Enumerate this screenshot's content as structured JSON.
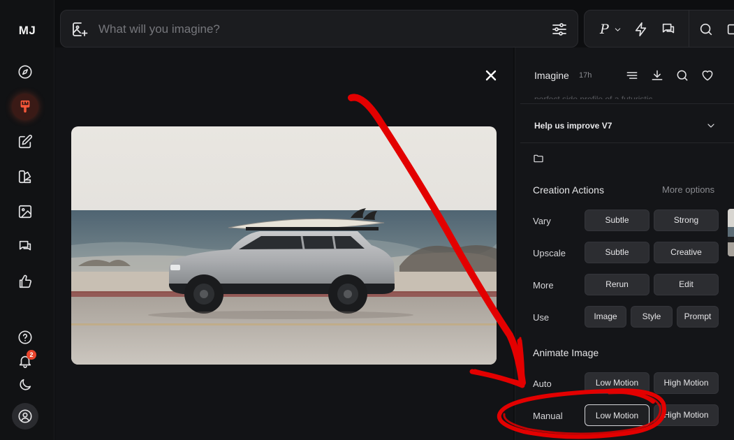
{
  "sidebar": {
    "logo": "MJ",
    "items": [
      {
        "name": "explore",
        "icon": "compass-icon"
      },
      {
        "name": "create",
        "icon": "paintbrush-icon",
        "active": true
      },
      {
        "name": "edit",
        "icon": "edit-icon"
      },
      {
        "name": "personalize",
        "icon": "palette-icon"
      },
      {
        "name": "organize",
        "icon": "image-icon"
      },
      {
        "name": "chat",
        "icon": "chat-icon"
      },
      {
        "name": "rank",
        "icon": "thumbs-up-icon"
      }
    ],
    "bottom": [
      {
        "name": "help",
        "icon": "help-icon"
      },
      {
        "name": "notifications",
        "icon": "bell-icon",
        "badge": "2"
      },
      {
        "name": "theme",
        "icon": "moon-icon"
      },
      {
        "name": "account",
        "icon": "user-icon"
      }
    ]
  },
  "search": {
    "placeholder": "What will you imagine?",
    "value": ""
  },
  "toolbar": {
    "personalize_label": "P"
  },
  "panel": {
    "title": "Imagine",
    "time": "17h",
    "prompt_preview": "perfect side profile of a futuristic",
    "help_label": "Help us improve V7",
    "creation_actions": {
      "title": "Creation Actions",
      "more_label": "More options",
      "rows": [
        {
          "label": "Vary",
          "buttons": [
            "Subtle",
            "Strong"
          ]
        },
        {
          "label": "Upscale",
          "buttons": [
            "Subtle",
            "Creative"
          ]
        },
        {
          "label": "More",
          "buttons": [
            "Rerun",
            "Edit"
          ]
        },
        {
          "label": "Use",
          "buttons": [
            "Image",
            "Style",
            "Prompt"
          ]
        }
      ]
    },
    "animate": {
      "title": "Animate Image",
      "rows": [
        {
          "label": "Auto",
          "buttons": [
            "Low Motion",
            "High Motion"
          ]
        },
        {
          "label": "Manual",
          "buttons": [
            "Low Motion",
            "High Motion"
          ],
          "highlighted": "Low Motion"
        }
      ]
    }
  },
  "colors": {
    "accent": "#ff5a3c",
    "annotation": "#e30000"
  }
}
